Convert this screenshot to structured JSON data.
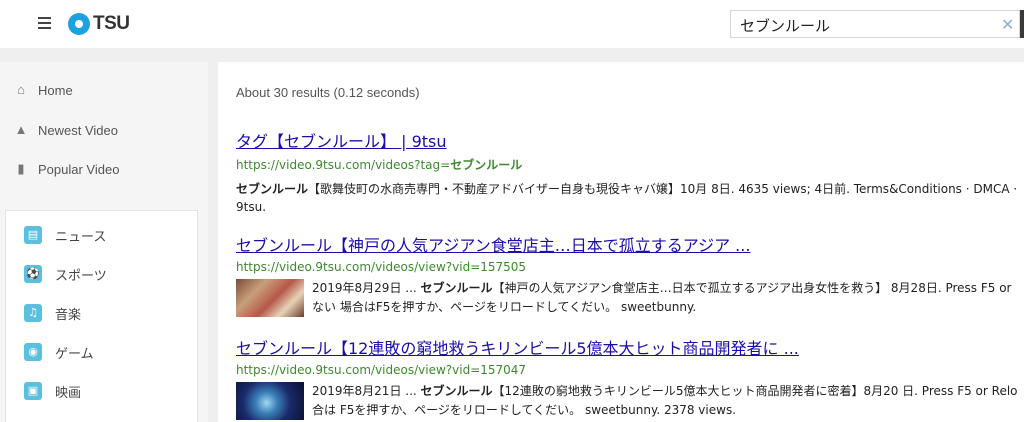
{
  "header": {
    "logo_text": "TSU",
    "search_value": "セブンルール",
    "clear_glyph": "✕"
  },
  "sidebar": {
    "nav": [
      {
        "label": "Home",
        "icon": "home-icon"
      },
      {
        "label": "Newest Video",
        "icon": "fire-icon"
      },
      {
        "label": "Popular Video",
        "icon": "thumbs-up-icon"
      }
    ],
    "categories": [
      {
        "label": "ニュース",
        "icon": "news-icon",
        "glyph": "▤"
      },
      {
        "label": "スポーツ",
        "icon": "soccer-ball-icon",
        "glyph": "⚽"
      },
      {
        "label": "音楽",
        "icon": "music-note-icon",
        "glyph": "♫"
      },
      {
        "label": "ゲーム",
        "icon": "gamepad-icon",
        "glyph": "◉"
      },
      {
        "label": "映画",
        "icon": "film-icon",
        "glyph": "▣"
      }
    ]
  },
  "main": {
    "stats": "About 30 results (0.12 seconds)",
    "results": [
      {
        "title": "タグ【セブンルール】 | 9tsu",
        "url_prefix": "https://video.9tsu.com/videos?tag=",
        "url_bold": "セブンルール",
        "snippet_bold": "セブンルール",
        "snippet_line1": "【歌舞伎町の水商売専門・不動産アドバイザー自身も現役キャバ嬢】10月 8日. 4635 views; 4日前. Terms&Conditions · DMCA ·",
        "snippet_line2": "9tsu."
      },
      {
        "title": "セブンルール【神戸の人気アジアン食堂店主…日本で孤立するアジア ...",
        "url": "https://video.9tsu.com/videos/view?vid=157505",
        "line1_prefix": "2019年8月29日 ... ",
        "line1_bold": "セブンルール",
        "line1_rest": "【神戸の人気アジアン食堂店主…日本で孤立するアジア出身女性を救う】 8月28日. Press F5 or",
        "line2": "ない 場合はF5を押すか、ページをリロードしてくだい。 sweetbunny."
      },
      {
        "title": "セブンルール【12連敗の窮地救うキリンビール5億本大ヒット商品開発者に ...",
        "url": "https://video.9tsu.com/videos/view?vid=157047",
        "line1_prefix": "2019年8月21日 ... ",
        "line1_bold": "セブンルール",
        "line1_rest": "【12連敗の窮地救うキリンビール5億本大ヒット商品開発者に密着】8月20 日. Press F5 or Relo",
        "line2": "合は F5を押すか、ページをリロードしてくだい。 sweetbunny. 2378 views."
      }
    ]
  }
}
